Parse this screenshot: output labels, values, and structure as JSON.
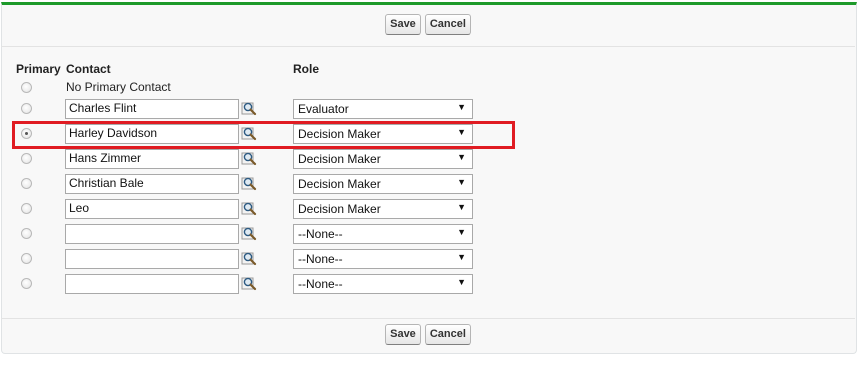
{
  "buttons": {
    "save_label": "Save",
    "cancel_label": "Cancel"
  },
  "headers": {
    "primary": "Primary",
    "contact": "Contact",
    "role": "Role"
  },
  "no_primary_label": "No Primary Contact",
  "rows": [
    {
      "contact": "Charles Flint",
      "role": "Evaluator",
      "primary": false
    },
    {
      "contact": "Harley Davidson",
      "role": "Decision Maker",
      "primary": true
    },
    {
      "contact": "Hans Zimmer",
      "role": "Decision Maker",
      "primary": false
    },
    {
      "contact": "Christian Bale",
      "role": "Decision Maker",
      "primary": false
    },
    {
      "contact": "Leo",
      "role": "Decision Maker",
      "primary": false
    },
    {
      "contact": "",
      "role": "--None--",
      "primary": false
    },
    {
      "contact": "",
      "role": "--None--",
      "primary": false
    },
    {
      "contact": "",
      "role": "--None--",
      "primary": false
    }
  ],
  "colors": {
    "accent_top_border": "#1d9a2a",
    "highlight_box": "#e01b22"
  },
  "icons": {
    "lookup": "magnifier-lookup-icon",
    "dropdown": "triangle-down-icon"
  }
}
